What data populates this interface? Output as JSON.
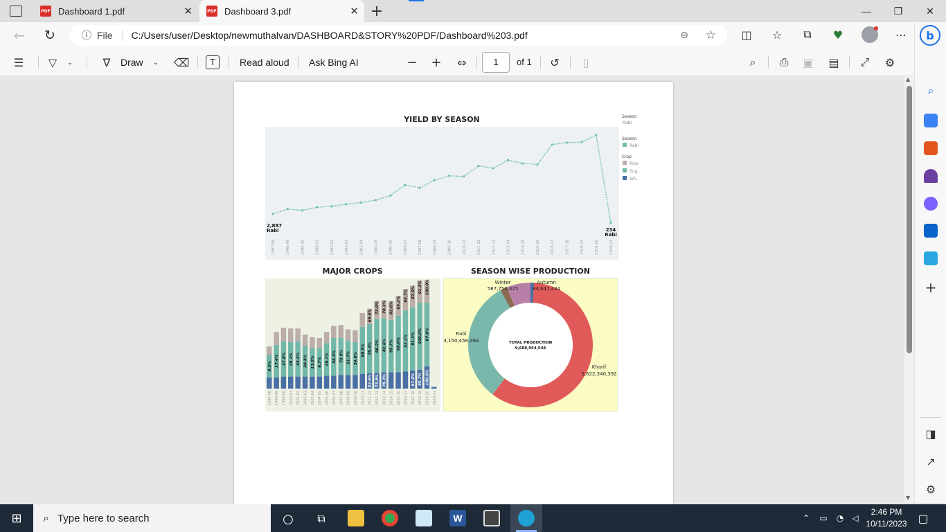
{
  "browser": {
    "tabs": [
      {
        "label": "Dashboard 1.pdf",
        "active": false
      },
      {
        "label": "Dashboard 3.pdf",
        "active": true
      }
    ],
    "new_tab_symbol": "+",
    "address_prefix": "File",
    "url": "C:/Users/user/Desktop/newmuthalvan/DASHBOARD&STORY%20PDF/Dashboard%203.pdf"
  },
  "pdf_toolbar": {
    "draw_label": "Draw",
    "read_aloud_label": "Read aloud",
    "ask_bing_label": "Ask Bing AI",
    "page_number": "1",
    "page_of": "of 1"
  },
  "dashboard": {
    "yield": {
      "title": "YIELD BY SEASON",
      "start_label_value": "2,887",
      "start_label_season": "Rabi",
      "end_label_value": "234",
      "end_label_season": "Rabi",
      "legend_season_header1": "Season",
      "legend_season_value1": "Rabi",
      "legend_season_header2": "Season",
      "legend_season_item": "Rabi",
      "legend_crop_header": "Crop",
      "legend_crop_items": [
        "Rice",
        "Sug..",
        "Wh.."
      ]
    },
    "major_crops": {
      "title": "MAJOR CROPS"
    },
    "season_prod": {
      "title": "SEASON WISE PRODUCTION",
      "center_label": "TOTAL PRODUCTION",
      "center_value": "9,688,954,548",
      "segments": [
        {
          "name": "Kharif",
          "value": "5,622,340,392"
        },
        {
          "name": "Rabi",
          "value": "3,150,456,464"
        },
        {
          "name": "Winter",
          "value": "587,750,325"
        },
        {
          "name": "Autumn",
          "value": "84,641,434"
        }
      ]
    }
  },
  "chart_data": [
    {
      "type": "line",
      "title": "YIELD BY SEASON",
      "x": [
        "1997-98",
        "1998-99",
        "1999-00",
        "2000-01",
        "2001-02",
        "2002-03",
        "2003-04",
        "2004-05",
        "2005-06",
        "2006-07",
        "2007-08",
        "2008-09",
        "2009-10",
        "2010-11",
        "2011-12",
        "2012-13",
        "2013-14",
        "2014-15",
        "2015-16",
        "2016-17",
        "2017-18",
        "2018-19",
        "2019-20",
        "2020-21"
      ],
      "series": [
        {
          "name": "Rabi",
          "values": [
            2887,
            4300,
            3900,
            4800,
            5100,
            5700,
            6200,
            6900,
            8200,
            11300,
            10500,
            12700,
            14000,
            13800,
            16900,
            16200,
            18600,
            17600,
            17300,
            23100,
            23700,
            23800,
            25900,
            234
          ]
        }
      ],
      "color": "#6fbfad"
    },
    {
      "type": "bar",
      "title": "MAJOR CROPS",
      "categories": [
        "1997-98",
        "1998-99",
        "1999-00",
        "2000-01",
        "2001-02",
        "2002-03",
        "2003-04",
        "2004-05",
        "2005-06",
        "2006-07",
        "2007-08",
        "2008-09",
        "2009-10",
        "2010-11",
        "2011-12",
        "2012-13",
        "2013-14",
        "2014-15",
        "2015-16",
        "2016-17",
        "2017-18",
        "2018-19",
        "2019-20",
        "2020-21"
      ],
      "series": [
        {
          "name": "Wh..",
          "values": [
            13,
            13,
            14,
            14,
            14,
            14,
            14,
            14,
            15,
            15,
            16,
            16,
            16,
            17,
            18,
            18,
            19,
            19,
            19,
            20,
            21,
            22,
            26,
            2
          ],
          "color": "#4a6fa5"
        },
        {
          "name": "Sug..",
          "values": [
            26,
            38,
            41,
            40,
            41,
            36,
            33,
            33,
            38,
            44,
            43,
            40,
            38,
            55,
            57,
            63,
            63,
            61,
            66,
            71,
            74,
            78,
            74,
            0
          ],
          "color": "#72b8aa"
        },
        {
          "name": "Rice",
          "values": [
            10,
            15,
            16,
            16,
            15,
            13,
            13,
            12,
            13,
            14,
            15,
            13,
            14,
            16,
            18,
            21,
            21,
            22,
            23,
            25,
            25,
            26,
            26,
            0
          ],
          "color": "#bbada8"
        }
      ],
      "labels_green": [
        "4.3%",
        "17.4%",
        "47.8%",
        "39.1%",
        "43.5%",
        "30.4%",
        "13.0%",
        "8.7%",
        "26.1%",
        "56.5%",
        "73.9%",
        "21.7%",
        "34.8%",
        "60.9%",
        "78.3%",
        "66.2%",
        "82.6%",
        "95.7%",
        "69.6%",
        "52.2%",
        "91.3%",
        "100.0%",
        "87.0%",
        ""
      ],
      "labels_top": [
        "",
        "",
        "",
        "",
        "",
        "",
        "",
        "",
        "",
        "",
        "",
        "",
        "",
        "",
        "69.6%",
        "73.9%",
        "78.3%",
        "82.6%",
        "65.2%",
        "95.7%",
        "87.0%",
        "91.3%",
        "100.0%",
        ""
      ],
      "labels_bottom": [
        "",
        "",
        "",
        "",
        "",
        "",
        "",
        "",
        "",
        "",
        "",
        "",
        "",
        "",
        "82.6%",
        "73.9%",
        "78.3%",
        "",
        "",
        "",
        "87.0%",
        "95.7%",
        "100.0%",
        ""
      ]
    },
    {
      "type": "pie",
      "title": "SEASON WISE PRODUCTION",
      "categories": [
        "Kharif",
        "Rabi",
        "Winter",
        "Autumn"
      ],
      "values": [
        5622340392,
        3150456464,
        587750325,
        84641434
      ],
      "colors": [
        "#e05a5a",
        "#7ab8ac",
        "#b880a8",
        "#4a6fa5"
      ],
      "extra_colors": [
        "#8a6a50"
      ]
    }
  ],
  "taskbar": {
    "search_placeholder": "Type here to search",
    "time": "2:46 PM",
    "date": "10/11/2023"
  }
}
